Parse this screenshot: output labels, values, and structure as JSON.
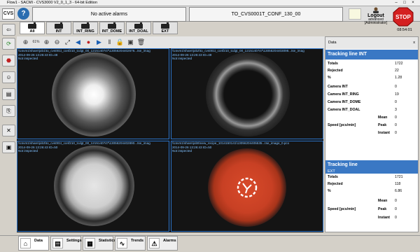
{
  "window": {
    "title": "Flow1 - SACMI - CVS3000 V2_0_1_3 - 64-bit Edition",
    "controls": [
      "–",
      "□",
      "×"
    ]
  },
  "header": {
    "logo": "CVS",
    "help_icon": "?",
    "alarm_status": "No active alarms",
    "config": "TO_CVS0001T_CONF_130_00",
    "logout_label": "Logout",
    "user_level": "advanced",
    "user_role": "[Administrator]",
    "stop_label": "STOP",
    "time": "08:54:01"
  },
  "tabs": [
    {
      "label": "All"
    },
    {
      "label": "INT"
    },
    {
      "label": "INT_RING"
    },
    {
      "label": "INT_DOME"
    },
    {
      "label": "INT_DOAL"
    },
    {
      "label": "EXT"
    }
  ],
  "toolbar": {
    "zoom": "61%"
  },
  "cells": [
    {
      "path": "\\\\csvm1\\share\\job1\\to_cvs001t_conf210_tcdgt_00_1215140747\\13056204402676...tse_imag",
      "ts": "2014-09-26 13:26:43 ID=48",
      "status": "Not inspected"
    },
    {
      "path": "\\\\csvm1\\share\\job2\\to_cvs001t_conf210_tcdgt_00_1215140747\\13056204403098...tse_imag",
      "ts": "2014-09-26 13:26:43 ID=49",
      "status": "Not inspected"
    },
    {
      "path": "\\\\csvm1\\share\\job3\\to_cvs001t_conf210_tcdgt_00_1215140747\\13056204402890...tse_imag",
      "ts": "2014-09-26 13:26:43 ID=50",
      "status": "Not inspected"
    },
    {
      "path": "\\\\csvm1\\share\\job5\\new_recipe_1014150141\\13056204405535...tse_image_0.pcx",
      "ts": "2014-09-26 13:26:43 ID=50",
      "status": "Not inspected"
    }
  ],
  "right": {
    "title": "Data",
    "close": "x",
    "int": {
      "title": "Tracking line INT",
      "rows": [
        [
          "Totals",
          "1722"
        ],
        [
          "Rejected",
          "22"
        ],
        [
          "%",
          "1.28"
        ],
        [
          "Camera INT",
          "0"
        ],
        [
          "Camera INT_RING",
          "19"
        ],
        [
          "Camera INT_DOME",
          "0"
        ],
        [
          "Camera INT_DOAL",
          "3"
        ]
      ],
      "speed_label": "Speed [pcs/min]",
      "speed": [
        [
          "Mean",
          "0"
        ],
        [
          "Peak",
          "0"
        ],
        [
          "Instant",
          "0"
        ]
      ]
    },
    "ext": {
      "title": "Tracking line",
      "sub": "EXT",
      "rows": [
        [
          "Totals",
          "1721"
        ],
        [
          "Rejected",
          "118"
        ],
        [
          "%",
          "6.86"
        ]
      ],
      "speed_label": "Speed [pcs/min]",
      "speed": [
        [
          "Mean",
          "0"
        ],
        [
          "Peak",
          "0"
        ],
        [
          "Instant",
          "0"
        ]
      ]
    }
  },
  "bottom": [
    {
      "label": "Data",
      "icon": "⌂"
    },
    {
      "label": "Settings",
      "icon": "▤"
    },
    {
      "label": "Statistics",
      "icon": "▦"
    },
    {
      "label": "Trends",
      "icon": "∿"
    },
    {
      "label": "Alarms",
      "icon": "⚠"
    }
  ]
}
